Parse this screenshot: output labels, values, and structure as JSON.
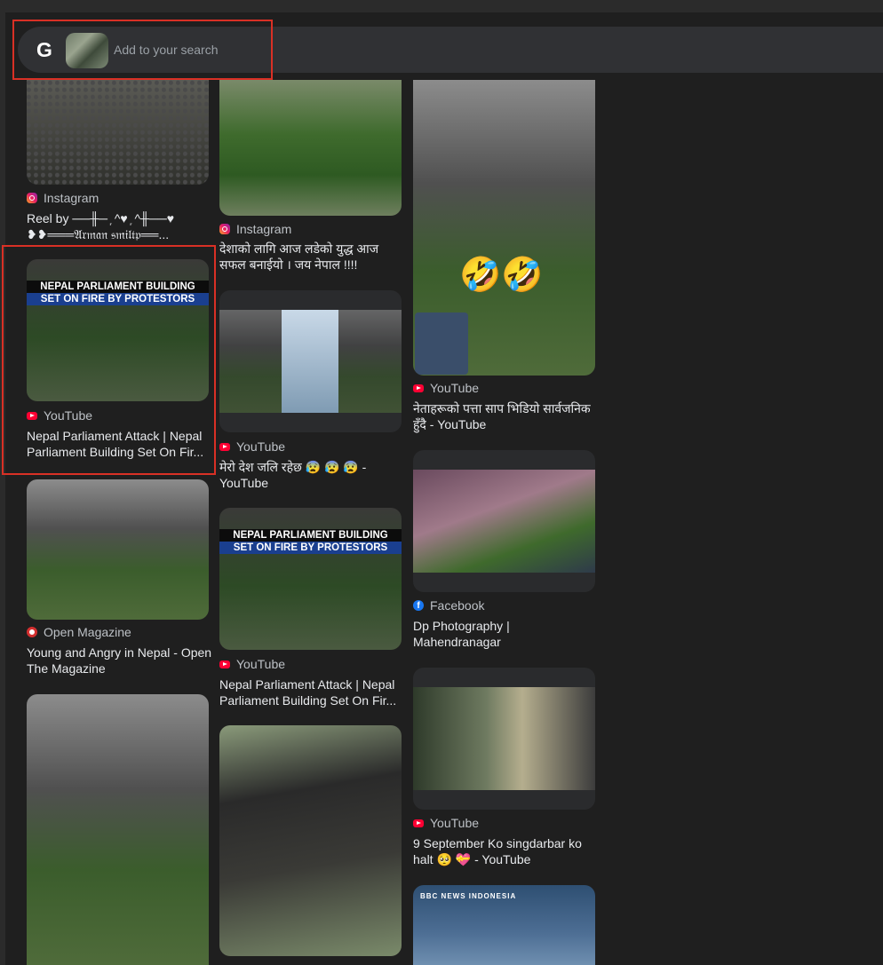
{
  "search": {
    "logo": "G",
    "placeholder": "Add to your search"
  },
  "cards": [
    {
      "source": "Instagram",
      "icon": "instagram-icon",
      "title": "Reel by ──╫─ ᷊ ^♥ ᷊ ^╫──♥ ❥❥═══𝔄𝔯𝔪𝔞𝔫 𝔰𝔪𝔦𝔩𝔱𝔭══..."
    },
    {
      "source": "YouTube",
      "icon": "youtube-icon",
      "title": "Nepal Parliament Attack | Nepal Parliament Building Set On Fir...",
      "banner_l1": "NEPAL PARLIAMENT BUILDING",
      "banner_l2": "SET ON FIRE BY PROTESTORS"
    },
    {
      "source": "Open Magazine",
      "icon": "open-magazine-icon",
      "title": "Young and Angry in Nepal - Open The Magazine"
    },
    {
      "source": "Instagram",
      "icon": "instagram-icon",
      "title": "देशाको लागि आज लडेको युद्ध आज सफल बनाईयो । जय नेपाल !!!!"
    },
    {
      "source": "YouTube",
      "icon": "youtube-icon",
      "title": "मेरो देश जलि रहेछ 😰 😰 😰 - YouTube"
    },
    {
      "source": "YouTube",
      "icon": "youtube-icon",
      "title": "Nepal Parliament Attack | Nepal Parliament Building Set On Fir...",
      "banner_l1": "NEPAL PARLIAMENT BUILDING",
      "banner_l2": "SET ON FIRE BY PROTESTORS"
    },
    {
      "source": "YouTube",
      "icon": "youtube-icon",
      "title": "नेताहरूको पत्ता साप भिडियो सार्वजनिक हुँदै - YouTube",
      "emoji": "🤣🤣"
    },
    {
      "source": "Facebook",
      "icon": "facebook-icon",
      "title": "Dp Photography | Mahendranagar"
    },
    {
      "source": "YouTube",
      "icon": "youtube-icon",
      "title": "9 September Ko singdarbar ko halt 🥺 💝 - YouTube"
    },
    {
      "bbc_label": "BBC NEWS INDONESIA"
    }
  ]
}
